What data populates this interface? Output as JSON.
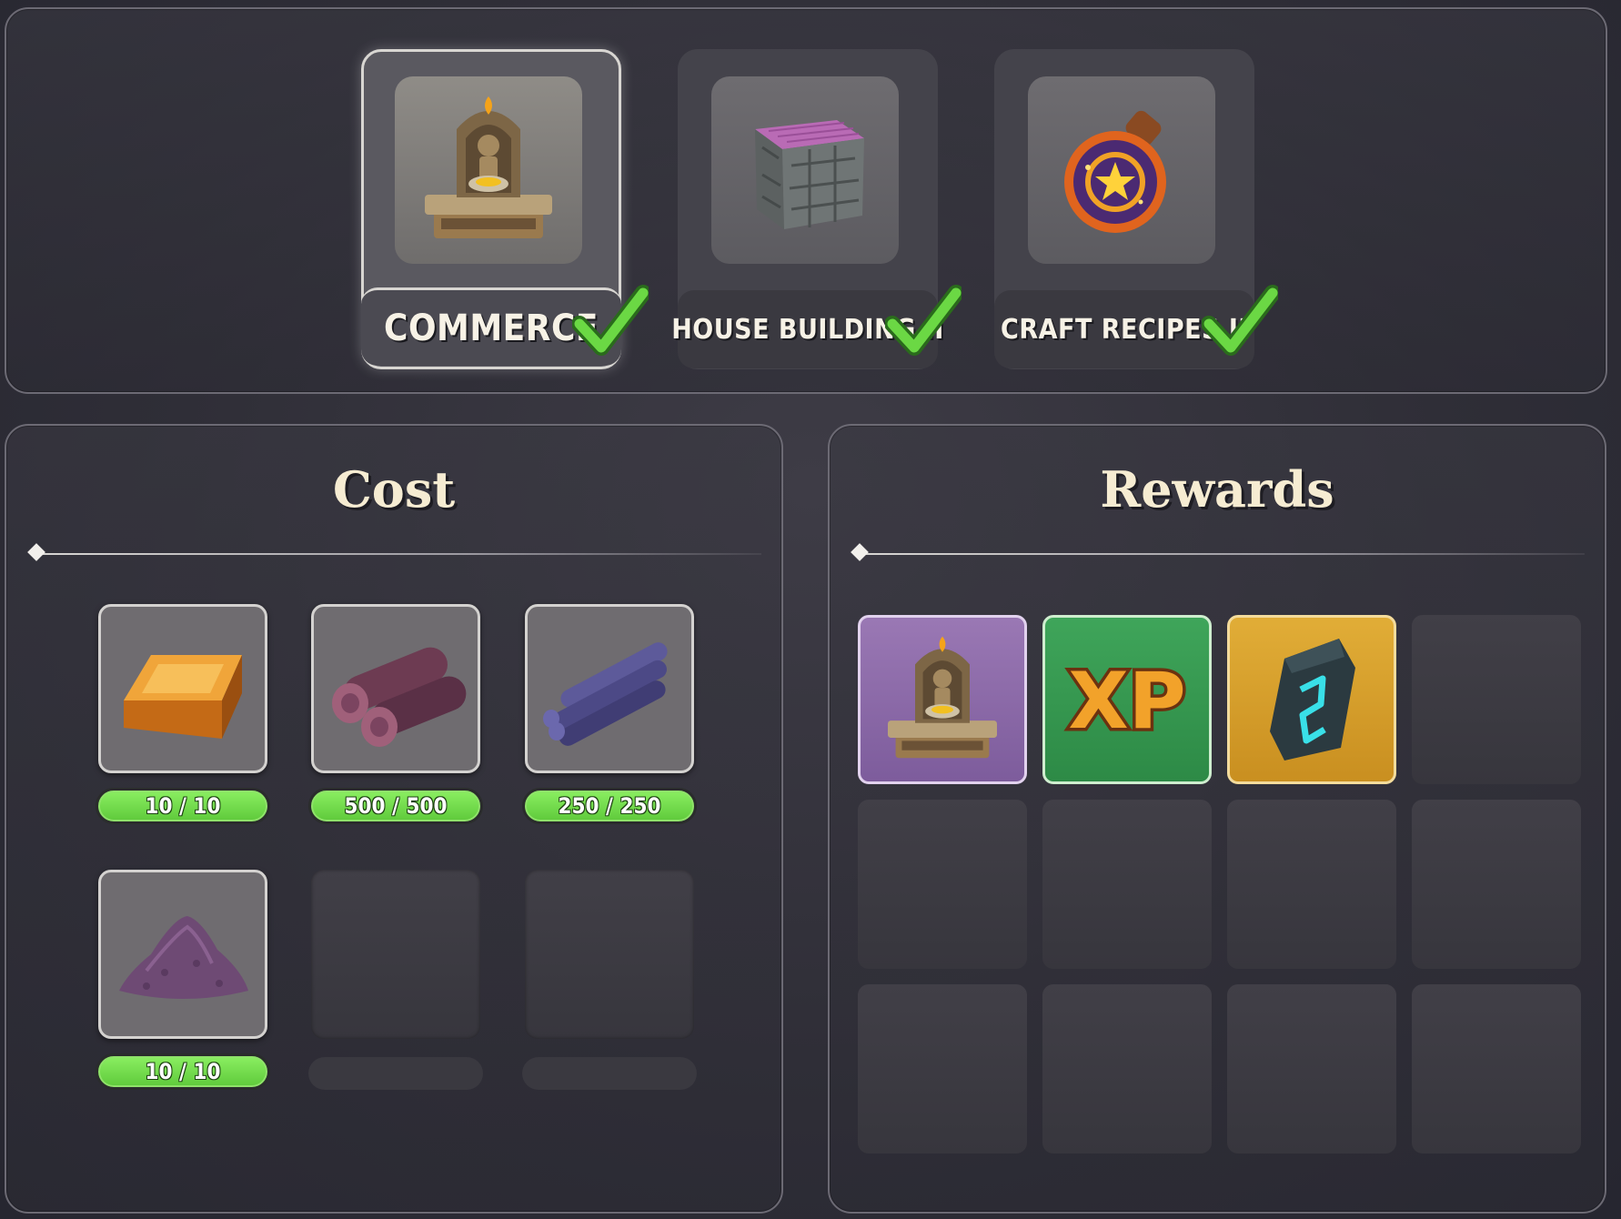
{
  "tabs": [
    {
      "label": "COMMERCE",
      "icon": "shrine-icon",
      "selected": true,
      "completed": true
    },
    {
      "label": "HOUSE BUILDING II",
      "icon": "stone-block-icon",
      "selected": false,
      "completed": true
    },
    {
      "label": "CRAFT RECIPES II",
      "icon": "potion-icon",
      "selected": false,
      "completed": true
    }
  ],
  "cost": {
    "title": "Cost",
    "items": [
      {
        "icon": "gold-ingot-icon",
        "amount": "10 / 10"
      },
      {
        "icon": "logs-icon",
        "amount": "500 / 500"
      },
      {
        "icon": "planks-icon",
        "amount": "250 / 250"
      },
      {
        "icon": "purple-dust-pile-icon",
        "amount": "10 / 10"
      }
    ]
  },
  "rewards": {
    "title": "Rewards",
    "items": [
      {
        "icon": "shrine-icon",
        "rarity_color": "#8a68a8"
      },
      {
        "icon": "xp-icon",
        "label": "XP",
        "rarity_color": "#359a50"
      },
      {
        "icon": "rune-stone-icon",
        "rarity_color": "#d89e2a"
      }
    ]
  },
  "colors": {
    "accent_green": "#6bd844",
    "panel_border": "#6c6a74",
    "title_cream": "#f6ecd2"
  }
}
